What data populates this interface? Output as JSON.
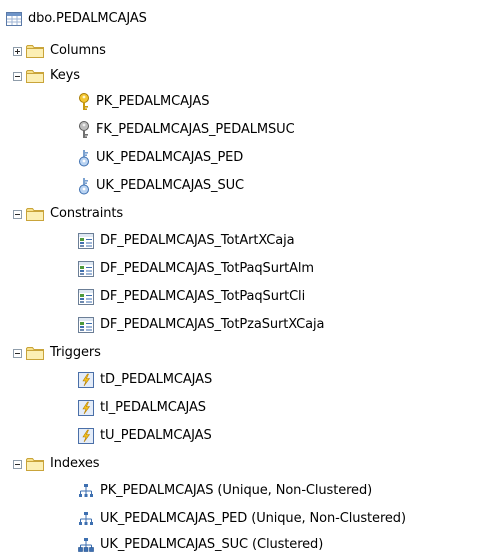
{
  "table": {
    "label": "dbo.PEDALMCAJAS",
    "icon": "table-icon"
  },
  "columns": {
    "label": "Columns",
    "icon": "folder-icon",
    "expanded": false
  },
  "keys": {
    "label": "Keys",
    "icon": "folder-icon",
    "expanded": true,
    "items": [
      {
        "label": "PK_PEDALMCAJAS",
        "icon": "primary-key-icon"
      },
      {
        "label": "FK_PEDALMCAJAS_PEDALMSUC",
        "icon": "foreign-key-icon"
      },
      {
        "label": "UK_PEDALMCAJAS_PED",
        "icon": "unique-key-icon"
      },
      {
        "label": "UK_PEDALMCAJAS_SUC",
        "icon": "unique-key-icon"
      }
    ]
  },
  "constraints": {
    "label": "Constraints",
    "icon": "folder-icon",
    "expanded": true,
    "items": [
      {
        "label": "DF_PEDALMCAJAS_TotArtXCaja",
        "icon": "constraint-icon"
      },
      {
        "label": "DF_PEDALMCAJAS_TotPaqSurtAlm",
        "icon": "constraint-icon"
      },
      {
        "label": "DF_PEDALMCAJAS_TotPaqSurtCli",
        "icon": "constraint-icon"
      },
      {
        "label": "DF_PEDALMCAJAS_TotPzaSurtXCaja",
        "icon": "constraint-icon"
      }
    ]
  },
  "triggers": {
    "label": "Triggers",
    "icon": "folder-icon",
    "expanded": true,
    "items": [
      {
        "label": "tD_PEDALMCAJAS",
        "icon": "trigger-icon"
      },
      {
        "label": "tI_PEDALMCAJAS",
        "icon": "trigger-icon"
      },
      {
        "label": "tU_PEDALMCAJAS",
        "icon": "trigger-icon"
      }
    ]
  },
  "indexes": {
    "label": "Indexes",
    "icon": "folder-icon",
    "expanded": true,
    "items": [
      {
        "label": "PK_PEDALMCAJAS (Unique, Non-Clustered)",
        "icon": "index-icon"
      },
      {
        "label": "UK_PEDALMCAJAS_PED (Unique, Non-Clustered)",
        "icon": "index-icon"
      },
      {
        "label": "UK_PEDALMCAJAS_SUC (Clustered)",
        "icon": "clustered-index-icon"
      }
    ]
  }
}
